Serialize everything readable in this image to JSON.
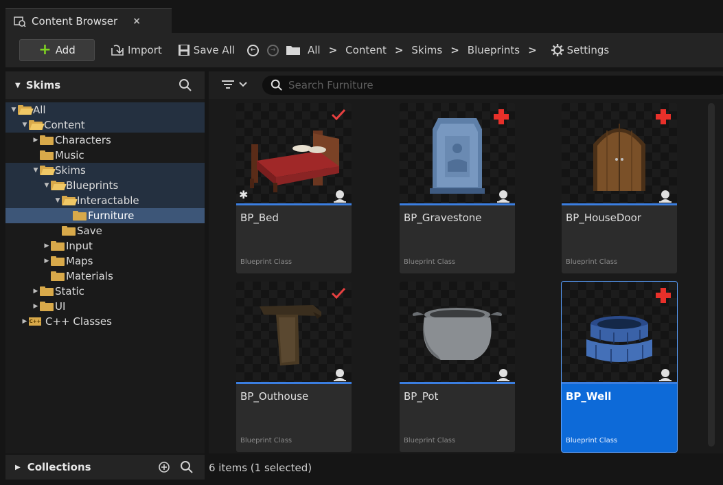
{
  "tab": {
    "title": "Content Browser",
    "close": "×",
    "icon": "content-browser-icon"
  },
  "toolbar": {
    "add_label": "Add",
    "import_label": "Import",
    "save_all_label": "Save All",
    "breadcrumbs": [
      "All",
      "Content",
      "Skims",
      "Blueprints"
    ],
    "settings_label": "Settings"
  },
  "left": {
    "header": "Skims",
    "collections_label": "Collections",
    "tree": [
      {
        "label": "All",
        "depth": 0,
        "expanded": true,
        "state": "hl"
      },
      {
        "label": "Content",
        "depth": 1,
        "expanded": true,
        "state": "hl"
      },
      {
        "label": "Characters",
        "depth": 2,
        "expanded": false,
        "state": ""
      },
      {
        "label": "Music",
        "depth": 2,
        "leaf": true,
        "state": ""
      },
      {
        "label": "Skims",
        "depth": 2,
        "expanded": true,
        "state": "hl"
      },
      {
        "label": "Blueprints",
        "depth": 3,
        "expanded": true,
        "state": "hl"
      },
      {
        "label": "Interactable",
        "depth": 4,
        "expanded": true,
        "state": "hl"
      },
      {
        "label": "Furniture",
        "depth": 5,
        "leaf": true,
        "state": "sel"
      },
      {
        "label": "Save",
        "depth": 4,
        "leaf": true,
        "state": ""
      },
      {
        "label": "Input",
        "depth": 3,
        "expanded": false,
        "state": ""
      },
      {
        "label": "Maps",
        "depth": 3,
        "expanded": false,
        "state": ""
      },
      {
        "label": "Materials",
        "depth": 3,
        "leaf": true,
        "state": ""
      },
      {
        "label": "Static",
        "depth": 2,
        "expanded": false,
        "state": ""
      },
      {
        "label": "UI",
        "depth": 2,
        "expanded": false,
        "state": ""
      },
      {
        "label": "C++ Classes",
        "depth": 1,
        "expanded": false,
        "cpp": true,
        "state": ""
      }
    ],
    "cpp_badge": "C++"
  },
  "search": {
    "placeholder": "Search Furniture"
  },
  "assets": [
    {
      "name": "BP_Bed",
      "type": "Blueprint Class",
      "badge": "check",
      "starred": true,
      "selected": false,
      "thumb": "bed"
    },
    {
      "name": "BP_Gravestone",
      "type": "Blueprint Class",
      "badge": "plus",
      "starred": false,
      "selected": false,
      "thumb": "gravestone"
    },
    {
      "name": "BP_HouseDoor",
      "type": "Blueprint Class",
      "badge": "plus",
      "starred": false,
      "selected": false,
      "thumb": "door"
    },
    {
      "name": "BP_Outhouse",
      "type": "Blueprint Class",
      "badge": "check",
      "starred": false,
      "selected": false,
      "thumb": "outhouse"
    },
    {
      "name": "BP_Pot",
      "type": "Blueprint Class",
      "badge": "",
      "starred": false,
      "selected": false,
      "thumb": "pot"
    },
    {
      "name": "BP_Well",
      "type": "Blueprint Class",
      "badge": "plus",
      "starred": false,
      "selected": true,
      "thumb": "well"
    }
  ],
  "status": "6 items (1 selected)",
  "colors": {
    "accent": "#0d6ad8",
    "check": "#e84040",
    "plus": "#e8302a",
    "folder": "#d8a94a"
  }
}
